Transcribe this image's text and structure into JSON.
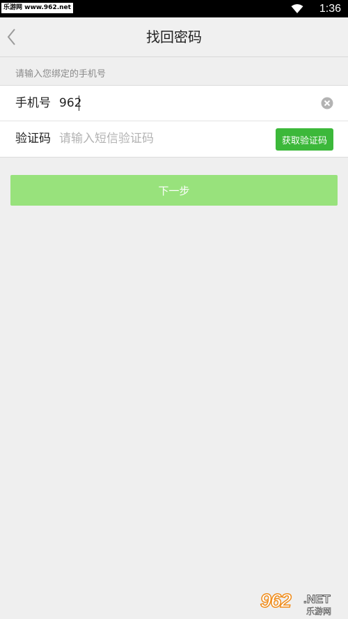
{
  "status_bar": {
    "watermark": "乐游网 www.962.net",
    "time": "1:36"
  },
  "header": {
    "title": "找回密码"
  },
  "hint": "请输入您绑定的手机号",
  "form": {
    "phone_label": "手机号",
    "phone_value": "962",
    "code_label": "验证码",
    "code_placeholder": "请输入短信验证码",
    "get_code_label": "获取验证码"
  },
  "next_label": "下一步",
  "footer_logo": {
    "number": "962",
    "suffix": ".NET",
    "subtitle": "乐游网"
  },
  "colors": {
    "accent_button": "#3cb83a",
    "next_button": "#98e27c",
    "background": "#efefef"
  },
  "icons": [
    "wifi-icon",
    "back-arrow-icon",
    "clear-icon"
  ]
}
